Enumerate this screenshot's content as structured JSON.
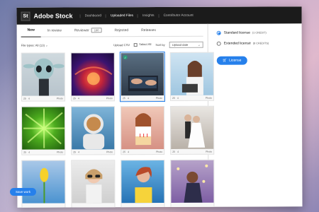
{
  "app": {
    "logo": "St",
    "title": "Adobe Stock"
  },
  "nav": [
    "Dashboard",
    "Uploaded Files",
    "Insights",
    "Contributor Account"
  ],
  "tabs": [
    {
      "label": "New",
      "active": true
    },
    {
      "label": "In review"
    },
    {
      "label": "Reviewer",
      "badge": "100"
    },
    {
      "label": "Rejected"
    },
    {
      "label": "Releases"
    }
  ],
  "filter": {
    "file_types": "File types: All (13)",
    "upload_csv": "Upload CSV",
    "select_all": "Select All",
    "sort_label": "Sort by",
    "sort_value": "Upload date"
  },
  "cards": [
    {
      "n": "25",
      "m": "4",
      "type": "Photo"
    },
    {
      "n": "25",
      "m": "4",
      "type": "Photo"
    },
    {
      "n": "25",
      "m": "4",
      "type": "Photo",
      "selected": true
    },
    {
      "n": "25",
      "m": "4",
      "type": "Photo"
    },
    {
      "n": "25",
      "m": "4",
      "type": "Photo"
    },
    {
      "n": "25",
      "m": "4",
      "type": "Photo"
    },
    {
      "n": "25",
      "m": "4",
      "type": "Photo"
    },
    {
      "n": "25",
      "m": "4",
      "type": "Photo"
    },
    {
      "n": "",
      "m": "",
      "type": ""
    },
    {
      "n": "",
      "m": "",
      "type": ""
    },
    {
      "n": "",
      "m": "",
      "type": ""
    },
    {
      "n": "",
      "m": "",
      "type": ""
    }
  ],
  "save_work": "Save work",
  "license": {
    "standard": "Standard license",
    "standard_credits": "(1 CREDIT)",
    "extended": "Extended license",
    "extended_credits": "(8 CREDITS)",
    "button": "License"
  },
  "colors": {
    "accent": "#2680eb",
    "topbar": "#1b1b1b"
  }
}
